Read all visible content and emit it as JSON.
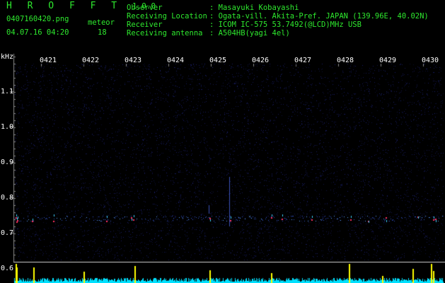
{
  "app": {
    "title": "H R O F F T",
    "version": "1.0.0"
  },
  "file": {
    "name": "0407160420.png",
    "datetime": "04.07.16 04:20"
  },
  "meteor": {
    "label": "meteor",
    "count": "18"
  },
  "info": [
    {
      "key": "Observer",
      "value": ": Masayuki Kobayashi"
    },
    {
      "key": "Receiving Location",
      "value": ": Ogata-vill. Akita-Pref. JAPAN (139.96E, 40.02N)"
    },
    {
      "key": "Receiver",
      "value": ": ICOM IC-575 53.7492(@LCD)MHz USB"
    },
    {
      "key": "Receiving antenna",
      "value": ": A504HB(yagi 4el)"
    }
  ],
  "axis": {
    "unit": "kHz",
    "time_labels": [
      "0421",
      "0422",
      "0423",
      "0424",
      "0425",
      "0426",
      "0427",
      "0428",
      "0429",
      "0430"
    ],
    "freq_labels": [
      "1.1",
      "1.0",
      "0.9",
      "0.8",
      "0.7",
      "0.6"
    ]
  },
  "colors": {
    "label": "#2ee82e",
    "background": "#000000",
    "noise": "#101560",
    "echo": "#ff3060",
    "bar": "#ffff00",
    "baseline": "#00e0ff"
  }
}
